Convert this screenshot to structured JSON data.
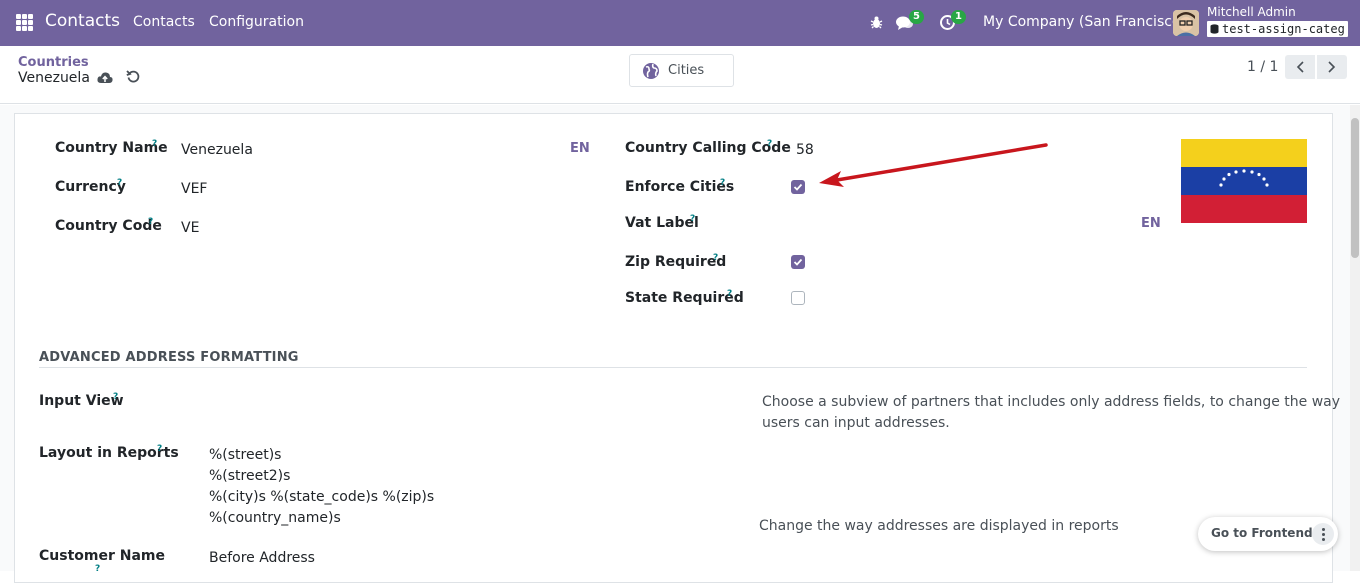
{
  "navbar": {
    "app_name": "Contacts",
    "menu_contacts": "Contacts",
    "menu_configuration": "Configuration",
    "messages_count": "5",
    "activities_count": "1",
    "company": "My Company (San Francisco)",
    "user_name": "Mitchell Admin",
    "database": "test-assign-categ",
    "bg_color": "#71639e"
  },
  "control_panel": {
    "breadcrumb": "Countries",
    "record_name": "Venezuela",
    "smart_button_label": "Cities",
    "pager": "1 / 1"
  },
  "form": {
    "country_name_label": "Country Name",
    "country_name": "Venezuela",
    "currency_label": "Currency",
    "currency": "VEF",
    "country_code_label": "Country Code",
    "country_code": "VE",
    "lang_badge": "EN",
    "calling_code_label": "Country Calling Code",
    "calling_code": "58",
    "enforce_cities_label": "Enforce Cities",
    "enforce_cities": true,
    "vat_label_label": "Vat Label",
    "vat_label": "",
    "zip_required_label": "Zip Required",
    "zip_required": true,
    "state_required_label": "State Required",
    "state_required": false,
    "hint_mark": "?"
  },
  "advanced": {
    "section_title": "ADVANCED ADDRESS FORMATTING",
    "input_view_label": "Input View",
    "input_view_help_1": "Choose a subview of partners that includes only address fields, to change the way",
    "input_view_help_2": "users can input addresses.",
    "layout_label": "Layout in Reports",
    "layout_lines": [
      "%(street)s",
      "%(street2)s",
      "%(city)s %(state_code)s %(zip)s",
      "%(country_name)s"
    ],
    "layout_help": "Change the way addresses are displayed in reports",
    "customer_name_label": "Customer Name",
    "customer_name_value": "Before Address"
  },
  "frontend_button": {
    "label": "Go to Frontend"
  },
  "icons": {
    "apps": "apps-grid-icon",
    "bug": "bug-icon",
    "chat": "chat-icon",
    "activity": "clock-icon",
    "save": "cloud-upload-icon",
    "discard": "undo-icon",
    "globe": "globe-icon",
    "arrow": "red-annotation-arrow",
    "flag": "venezuela-flag"
  }
}
